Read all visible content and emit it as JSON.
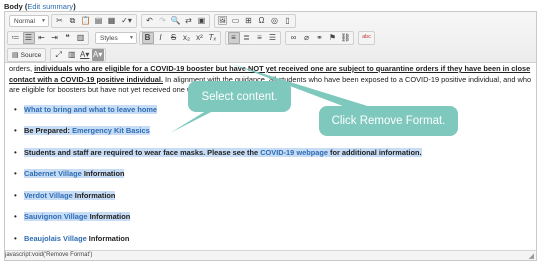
{
  "field": {
    "label": "Body",
    "edit_link": "Edit summary"
  },
  "toolbar": {
    "format_combo": "Normal",
    "styles_combo": "Styles",
    "source_label": "Source"
  },
  "content": {
    "para_pre": "orders, ",
    "para_u1": "individuals who are eligible for a COVID-19 booster but have NOT yet received one are subject to quarantine orders if they have been in close contact with a COVID-19 positive individual.",
    "para_post": " In alignment with the guidance, all students who have been exposed to a COVID-19 positive individual, and who are eligible for boosters but have not yet received one will need to quarantine.",
    "items": [
      {
        "link": "What to bring and what to leave home",
        "tail": "",
        "pre": ""
      },
      {
        "pre": "Be Prepared: ",
        "link": "Emergency Kit Basics",
        "tail": ""
      },
      {
        "pre": "Students and staff are required to wear face masks. Please see the ",
        "link": "COVID-19 webpage",
        "tail": " for additional information."
      },
      {
        "pre": "",
        "link": "Cabernet Village",
        "tail": " Information"
      },
      {
        "pre": "",
        "link": "Verdot Village",
        "tail": " Information"
      },
      {
        "pre": "",
        "link": "Sauvignon Village",
        "tail": " Information"
      },
      {
        "pre": "",
        "link": "Beaujolais Village",
        "tail": " Information"
      }
    ]
  },
  "statusbar": {
    "text": "javascript:void('Remove Format')"
  },
  "callouts": {
    "select": "Select content.",
    "remove": "Click Remove Format."
  },
  "colors": {
    "callout": "#7ec8bd",
    "selection": "#c7dcf5",
    "link": "#2e6db4"
  }
}
